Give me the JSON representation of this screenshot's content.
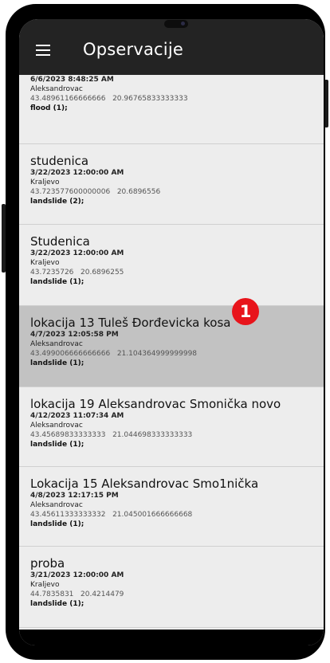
{
  "app_bar": {
    "title": "Opservacije",
    "menu_icon": "hamburger-menu-icon"
  },
  "observations": [
    {
      "title": "",
      "date": "6/6/2023 8:48:25 AM",
      "place": "Aleksandrovac",
      "lat": "43.48961166666666",
      "lon": "20.96765833333333",
      "type": "flood (1);"
    },
    {
      "title": "studenica",
      "date": "3/22/2023 12:00:00 AM",
      "place": "Kraljevo",
      "lat": "43.723577600000006",
      "lon": "20.6896556",
      "type": "landslide (2);"
    },
    {
      "title": "Studenica",
      "date": "3/22/2023 12:00:00 AM",
      "place": "Kraljevo",
      "lat": "43.7235726",
      "lon": "20.6896255",
      "type": "landslide (1);"
    },
    {
      "title": "lokacija 13 Tuleš Đorđevicka kosa",
      "date": "4/7/2023 12:05:58 PM",
      "place": "Aleksandrovac",
      "lat": "43.499006666666666",
      "lon": "21.104364999999998",
      "type": "landslide (1);",
      "selected": true
    },
    {
      "title": "lokacija 19 Aleksandrovac Smonička novo",
      "date": "4/12/2023 11:07:34 AM",
      "place": "Aleksandrovac",
      "lat": "43.45689833333333",
      "lon": "21.044698333333333",
      "type": "landslide (1);"
    },
    {
      "title": "Lokacija 15 Aleksandrovac Smo1nička",
      "date": "4/8/2023 12:17:15 PM",
      "place": "Aleksandrovac",
      "lat": "43.45611333333332",
      "lon": "21.045001666666668",
      "type": "landslide (1);"
    },
    {
      "title": "proba",
      "date": "3/21/2023 12:00:00 AM",
      "place": "Kraljevo",
      "lat": "44.7835831",
      "lon": "20.4214479",
      "type": "landslide (1);"
    }
  ],
  "badge": {
    "number": "1",
    "color": "#e8141b"
  },
  "colors": {
    "app_bar": "#232323",
    "list_bg": "#ededed",
    "selected_row": "#c2c2c2"
  }
}
